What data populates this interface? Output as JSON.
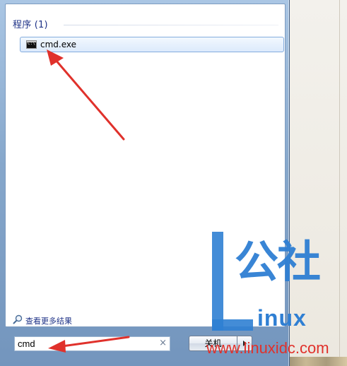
{
  "start_menu": {
    "section_header": "程序 (1)",
    "results": [
      {
        "label": "cmd.exe",
        "icon": "cmd-icon"
      }
    ],
    "see_more": "查看更多结果",
    "search": {
      "value": "cmd",
      "clear_symbol": "×"
    },
    "shutdown_label": "关机"
  },
  "watermark": {
    "cn": "公社",
    "linux": "inux",
    "url": "www.linuxidc.com"
  },
  "colors": {
    "accent": "#1e3287",
    "selection_border": "#84acdd",
    "annotation_arrow": "#e0312b",
    "watermark": "#2f7fd3"
  }
}
